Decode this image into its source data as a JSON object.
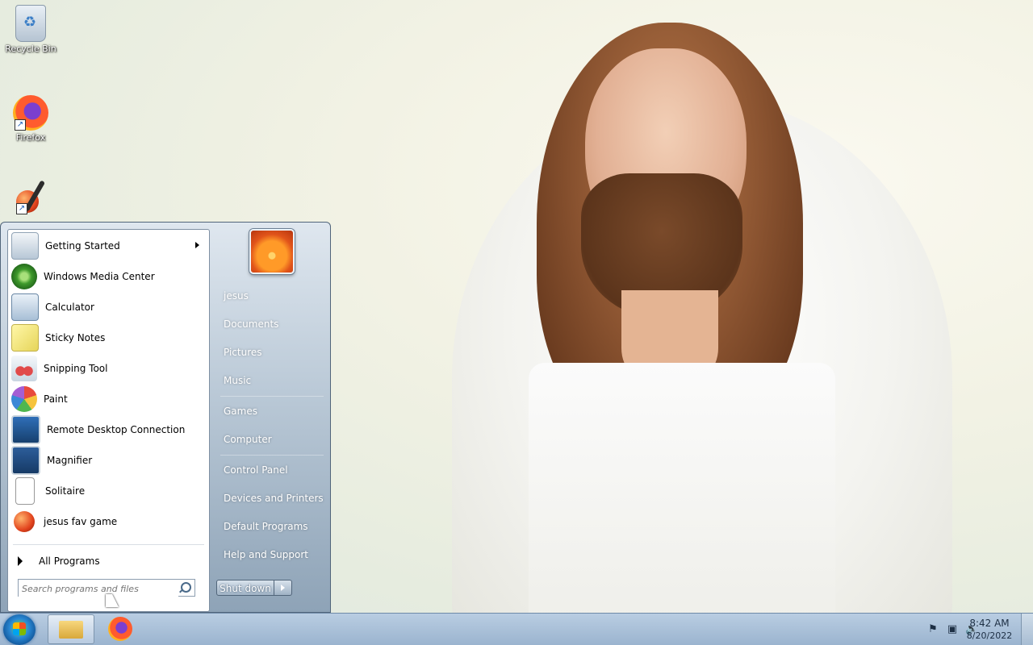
{
  "desktop": {
    "icons": [
      {
        "label": "Recycle Bin",
        "icon": "recycle-bin-icon"
      },
      {
        "label": "Firefox",
        "icon": "firefox-icon"
      },
      {
        "label": "",
        "icon": "paint-game-icon"
      }
    ]
  },
  "start_menu": {
    "programs": [
      {
        "label": "Getting Started",
        "icon": "getting-started-icon",
        "has_submenu": true
      },
      {
        "label": "Windows Media Center",
        "icon": "media-center-icon"
      },
      {
        "label": "Calculator",
        "icon": "calculator-icon"
      },
      {
        "label": "Sticky Notes",
        "icon": "sticky-notes-icon"
      },
      {
        "label": "Snipping Tool",
        "icon": "snipping-tool-icon"
      },
      {
        "label": "Paint",
        "icon": "paint-icon"
      },
      {
        "label": "Remote Desktop Connection",
        "icon": "remote-desktop-icon"
      },
      {
        "label": "Magnifier",
        "icon": "magnifier-icon"
      },
      {
        "label": "Solitaire",
        "icon": "solitaire-icon"
      },
      {
        "label": "jesus fav game",
        "icon": "paint-game-icon"
      }
    ],
    "all_programs_label": "All Programs",
    "search_placeholder": "Search programs and files",
    "right_links": {
      "user": "jesus",
      "documents": "Documents",
      "pictures": "Pictures",
      "music": "Music",
      "games": "Games",
      "computer": "Computer",
      "control_panel": "Control Panel",
      "devices": "Devices and Printers",
      "default_programs": "Default Programs",
      "help": "Help and Support"
    },
    "shutdown_label": "Shut down"
  },
  "taskbar": {
    "pinned": [
      {
        "icon": "windows-explorer-icon"
      },
      {
        "icon": "firefox-icon"
      }
    ],
    "tray_icons": [
      "action-center-flag-icon",
      "network-icon",
      "volume-icon"
    ],
    "time": "8:42 AM",
    "date": "8/20/2022"
  },
  "colors": {
    "taskbar": "#9bb4cf",
    "start_menu_right": "#8ea3b7"
  }
}
